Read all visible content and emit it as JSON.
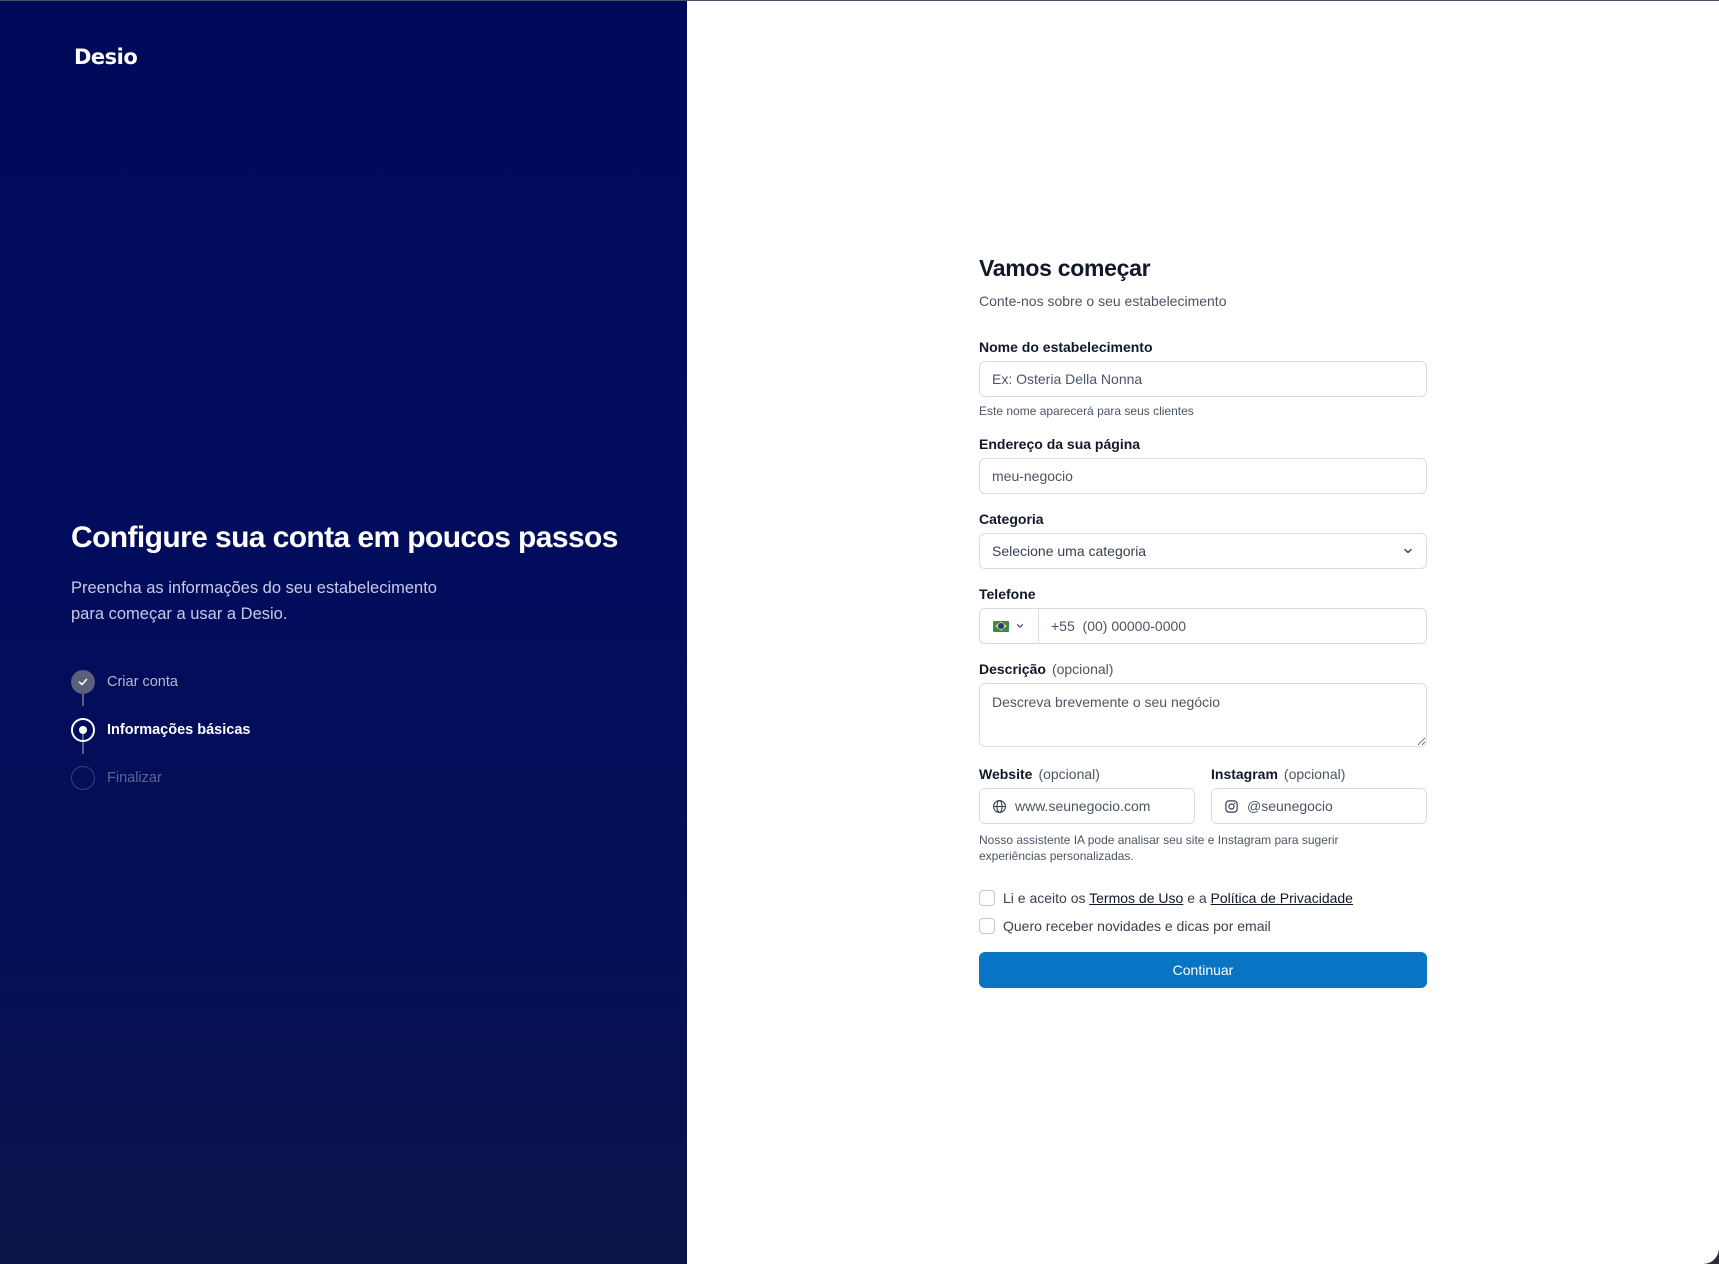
{
  "brand": {
    "logo": "Desio"
  },
  "hero": {
    "title": "Configure sua conta em poucos passos",
    "subtitle_line1": "Preencha as informações do seu estabelecimento",
    "subtitle_line2": "para começar a usar a Desio."
  },
  "steps": [
    {
      "label": "Criar conta",
      "state": "done"
    },
    {
      "label": "Informações básicas",
      "state": "active"
    },
    {
      "label": "Finalizar",
      "state": "pending"
    }
  ],
  "form": {
    "title": "Vamos começar",
    "subtitle": "Conte-nos sobre o seu estabelecimento",
    "name": {
      "label": "Nome do estabelecimento",
      "placeholder": "Ex: Osteria Della Nonna",
      "hint": "Este nome aparecerá para seus clientes"
    },
    "address": {
      "label": "Endereço da sua página",
      "placeholder": "meu-negocio"
    },
    "category": {
      "label": "Categoria",
      "value": "Selecione uma categoria"
    },
    "phone": {
      "label": "Telefone",
      "placeholder": "+55  (00) 00000-0000",
      "country_icon": "brazil-flag-icon"
    },
    "description": {
      "label": "Descrição",
      "optional": "(opcional)",
      "placeholder": "Descreva brevemente o seu negócio"
    },
    "website": {
      "label": "Website",
      "optional": "(opcional)",
      "placeholder": "www.seunegocio.com",
      "icon": "globe-icon"
    },
    "instagram": {
      "label": "Instagram",
      "optional": "(opcional)",
      "placeholder": "@seunegocio",
      "icon": "instagram-icon"
    },
    "ai_hint": "Nosso assistente IA pode analisar seu site e Instagram para sugerir experiências personalizadas.",
    "terms": {
      "prefix": "Li e aceito os",
      "terms_link": "Termos de Uso",
      "middle": "e a",
      "privacy_link": "Política de Privacidade"
    },
    "newsletter": "Quero receber novidades e dicas por email",
    "submit": "Continuar"
  },
  "colors": {
    "panel_bg": "#01095a",
    "primary_button": "#0774c4",
    "input_border": "#d9dde3"
  }
}
